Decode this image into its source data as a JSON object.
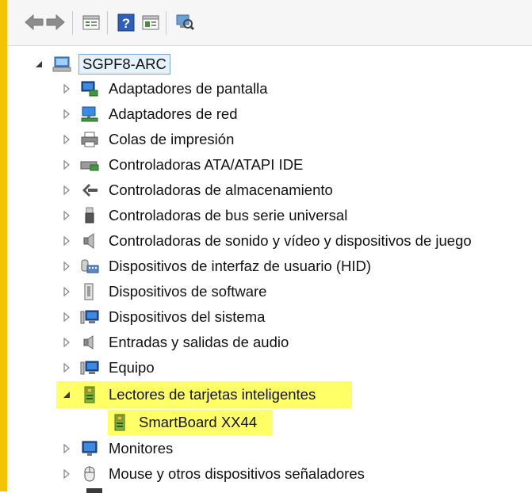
{
  "toolbar": {
    "buttons": [
      {
        "name": "back-button",
        "icon": "arrow-left-icon"
      },
      {
        "name": "forward-button",
        "icon": "arrow-right-icon"
      },
      {
        "name": "properties-button",
        "icon": "properties-icon"
      },
      {
        "name": "help-button",
        "icon": "help-icon"
      },
      {
        "name": "view-button",
        "icon": "view-icon"
      },
      {
        "name": "scan-hardware-button",
        "icon": "scan-hardware-icon"
      }
    ]
  },
  "tree": {
    "root": {
      "label": "SGPF8-ARC",
      "icon": "computer-icon"
    },
    "items": [
      {
        "label": "Adaptadores de pantalla",
        "icon": "display-adapter-icon"
      },
      {
        "label": "Adaptadores de red",
        "icon": "network-adapter-icon"
      },
      {
        "label": "Colas de impresión",
        "icon": "printer-icon"
      },
      {
        "label": "Controladoras ATA/ATAPI IDE",
        "icon": "ide-controller-icon"
      },
      {
        "label": "Controladoras de almacenamiento",
        "icon": "storage-controller-icon"
      },
      {
        "label": "Controladoras de bus serie universal",
        "icon": "usb-icon"
      },
      {
        "label": "Controladoras de sonido y vídeo y dispositivos de juego",
        "icon": "speaker-icon"
      },
      {
        "label": "Dispositivos de interfaz de usuario (HID)",
        "icon": "hid-icon"
      },
      {
        "label": "Dispositivos de software",
        "icon": "software-device-icon"
      },
      {
        "label": "Dispositivos del sistema",
        "icon": "system-device-icon"
      },
      {
        "label": "Entradas y salidas de audio",
        "icon": "audio-io-icon"
      },
      {
        "label": "Equipo",
        "icon": "computer-icon"
      },
      {
        "label": "Lectores de tarjetas inteligentes",
        "icon": "smart-card-reader-icon",
        "expanded": true,
        "highlight": "#ffff66",
        "children": [
          {
            "label": "SmartBoard XX44",
            "icon": "smart-card-reader-icon",
            "highlight": "#ffff66"
          }
        ]
      },
      {
        "label": "Monitores",
        "icon": "monitor-icon"
      },
      {
        "label": "Mouse y otros dispositivos señaladores",
        "icon": "mouse-icon"
      }
    ]
  },
  "colors": {
    "accent_bar": "#f5c400",
    "highlight": "#ffff66",
    "selection_border": "#7aa7d6"
  }
}
